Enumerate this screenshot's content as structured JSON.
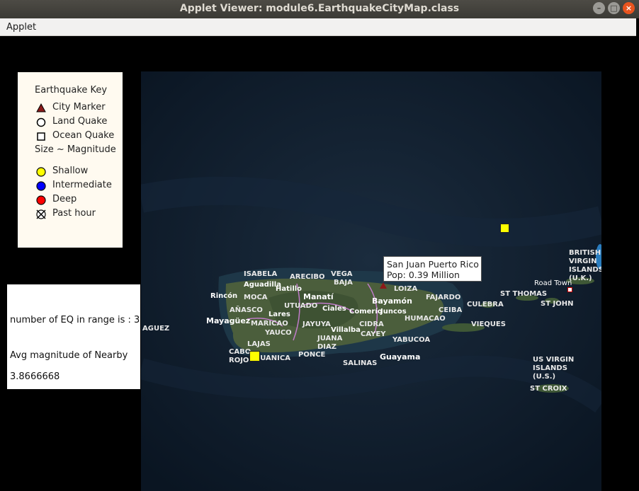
{
  "window": {
    "title": "Applet Viewer: module6.EarthquakeCityMap.class",
    "controls": [
      "minimize",
      "maximize",
      "close"
    ]
  },
  "menubar": {
    "items": [
      "Applet"
    ]
  },
  "key": {
    "title": "Earthquake Key",
    "items": [
      {
        "label": "City Marker",
        "icon": "triangle-icon",
        "color": "#8b1a1a"
      },
      {
        "label": "Land Quake",
        "icon": "circle-outline-icon",
        "color": "#ffffff"
      },
      {
        "label": "Ocean Quake",
        "icon": "square-outline-icon",
        "color": "#ffffff"
      },
      {
        "label": "Size ~ Magnitude"
      },
      {
        "label": "Shallow",
        "icon": "circle-icon",
        "color": "#ffff00"
      },
      {
        "label": "Intermediate",
        "icon": "circle-icon",
        "color": "#0000ff"
      },
      {
        "label": "Deep",
        "icon": "circle-icon",
        "color": "#ff0000"
      },
      {
        "label": "Past hour",
        "icon": "crossed-circle-icon",
        "color": "#ffffff"
      }
    ]
  },
  "info_panel": {
    "count_text": "number of EQ in range is : 3",
    "avg_label": "Avg magnitude of Nearby",
    "avg_value": "3.8666668"
  },
  "tooltip": {
    "line1": "San Juan Puerto Rico",
    "line2": "Pop: 0.39 Million"
  },
  "map_labels": {
    "isabela": "ISABELA",
    "arecibo": "ARECIBO",
    "vega_baja": "VEGA\nBAJA",
    "aguadilla": "Aguadilla",
    "hatillo": "Hatillo",
    "rincon": "Rincón",
    "anasco": "AÑASCO",
    "moca": "MOCA",
    "manati": "Manatí",
    "bayamon": "Bayamón",
    "loiza": "LOIZA",
    "fajardo": "FAJARDO",
    "ciales": "Ciales",
    "utuado": "UTUADO",
    "lares": "Lares",
    "comerio": "Comerío",
    "juncos": "Juncos",
    "ceiba": "CEIBA",
    "culebra": "CULEBRA",
    "st_thomas": "ST THOMAS",
    "st_john": "ST JOHN",
    "road_town": "Road Town",
    "bvi": "BRITISH\nVIRGIN\nISLANDS\n(U.K.)",
    "mayaguez": "Mayagüez",
    "maricao": "MARICAO",
    "jayuya": "JAYUYA",
    "yauco": "YAUCO",
    "villalba": "Villalba",
    "cidra": "CIDRA",
    "cayey": "CAYEY",
    "humacao": "HUMACAO",
    "vieques": "VIEQUES",
    "juana_diaz": "JUANA\nDIAZ",
    "yabucoa": "YABUCOA",
    "cabo_rojo": "CABO\nROJO",
    "lajas": "LAJAS",
    "guanica": "GUANICA",
    "ponce": "PONCE",
    "salinas": "SALINAS",
    "guayama": "Guayama",
    "usvi": "US VIRGIN\nISLANDS\n(U.S.)",
    "st_croix": "ST CROIX",
    "aguez": "AGUEZ"
  },
  "colors": {
    "ocean": "#0d1a2a",
    "land": "#4b5e3c",
    "key_bg": "#fffaf0",
    "quake_shallow": "#ffff00",
    "city_marker": "#8b1a1a"
  }
}
